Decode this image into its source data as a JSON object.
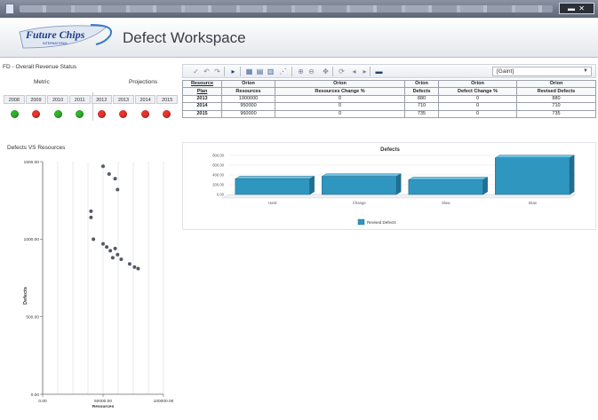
{
  "app": {
    "title": "Defect Workspace",
    "logo_text": "Future Chips",
    "logo_subtext": "INTERNATIONAL"
  },
  "left_panel": {
    "header": "FD - Overall Revenue Status",
    "kpi": {
      "metric_label": "Metric",
      "projection_label": "Projections",
      "years": [
        "2008",
        "2009",
        "2010",
        "2011",
        "2012",
        "2013",
        "2014",
        "2015"
      ],
      "statuses": [
        "green",
        "red",
        "green",
        "green",
        "red",
        "red",
        "red",
        "red"
      ],
      "colors": {
        "green": "#2db42a",
        "red": "#e8352c"
      }
    },
    "scatter_title": "Defects VS Resources"
  },
  "toolbar": {
    "selected_view": "[Gaint]",
    "icons": [
      "check-icon",
      "undo-icon",
      "redo-icon",
      "pointer-icon",
      "grid-icon",
      "table-icon",
      "bar-chart-icon",
      "scatter-icon",
      "zoom-in-icon",
      "zoom-out-icon",
      "pan-icon",
      "refresh-icon",
      "back-icon",
      "forward-icon",
      "chart-type-icon"
    ]
  },
  "table": {
    "header_row1": [
      "Resource",
      "Orion",
      "Orion",
      "Orion",
      "Orion",
      "Orion"
    ],
    "header_row2": [
      "Plan",
      "Resources",
      "Resources Change %",
      "Defects",
      "Defect Change %",
      "Revised Defects"
    ],
    "rows": [
      [
        "2013",
        "1900000",
        "0",
        "880",
        "0",
        "880"
      ],
      [
        "2014",
        "950000",
        "0",
        "710",
        "0",
        "710"
      ],
      [
        "2015",
        "960000",
        "0",
        "735",
        "0",
        "735"
      ]
    ]
  },
  "chart_data": [
    {
      "type": "scatter",
      "title": "Defects VS Resources",
      "xlabel": "Resources",
      "ylabel": "Defects",
      "xticks": [
        "0.00",
        "50000.00",
        "100000.00"
      ],
      "yticks": [
        "0.00",
        "500.00",
        "1000.00",
        "1500.00"
      ],
      "xlim": [
        0,
        100000
      ],
      "ylim": [
        0,
        1500
      ],
      "points": [
        {
          "x": 50000,
          "y": 1470
        },
        {
          "x": 55000,
          "y": 1420
        },
        {
          "x": 60000,
          "y": 1390
        },
        {
          "x": 62000,
          "y": 1320
        },
        {
          "x": 40000,
          "y": 1180
        },
        {
          "x": 40000,
          "y": 1140
        },
        {
          "x": 42000,
          "y": 1000
        },
        {
          "x": 50000,
          "y": 970
        },
        {
          "x": 53000,
          "y": 950
        },
        {
          "x": 56000,
          "y": 925
        },
        {
          "x": 60000,
          "y": 940
        },
        {
          "x": 62000,
          "y": 900
        },
        {
          "x": 58000,
          "y": 880
        },
        {
          "x": 65000,
          "y": 870
        },
        {
          "x": 72000,
          "y": 840
        },
        {
          "x": 76000,
          "y": 820
        },
        {
          "x": 79000,
          "y": 810
        }
      ],
      "grid": true,
      "point_color": "#555a66"
    },
    {
      "type": "bar",
      "title": "Defects",
      "categories": [
        "Hard",
        "Change",
        "Slow",
        "Slow"
      ],
      "series": [
        {
          "name": "Revised Defects",
          "values": [
            320,
            370,
            300,
            750
          ],
          "color": "#2f96c0"
        }
      ],
      "yticks": [
        "0.00",
        "200.00",
        "400.00",
        "600.00",
        "800.00"
      ],
      "ylim": [
        0,
        800
      ],
      "legend": "bottom"
    }
  ]
}
